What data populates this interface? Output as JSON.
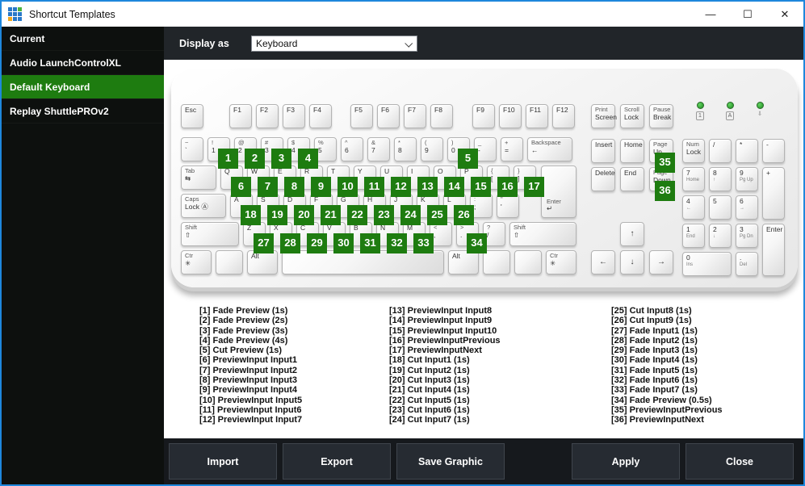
{
  "colors": {
    "accent_green": "#1e7c10",
    "window_border_blue": "#1e87dc",
    "led_green": "#2f9a2f"
  },
  "window": {
    "title": "Shortcut Templates",
    "controls": {
      "minimize": "—",
      "maximize": "☐",
      "close": "✕"
    },
    "icon_cells": [
      "#2878c8",
      "#2878c8",
      "#4ab33e",
      "#2878c8",
      "#2878c8",
      "#2878c8",
      "#f2a71b",
      "#2878c8",
      "#2878c8"
    ]
  },
  "sidebar": {
    "items": [
      {
        "label": "Current",
        "selected": false
      },
      {
        "label": "Audio LaunchControlXL",
        "selected": false
      },
      {
        "label": "Default Keyboard",
        "selected": true
      },
      {
        "label": "Replay ShuttlePROv2",
        "selected": false
      }
    ]
  },
  "toolbar": {
    "display_as_label": "Display as",
    "display_as_value": "Keyboard"
  },
  "keyboard": {
    "esc": {
      "l": "Esc"
    },
    "fn_groups": [
      [
        {
          "l": "F1"
        },
        {
          "l": "F2"
        },
        {
          "l": "F3"
        },
        {
          "l": "F4"
        }
      ],
      [
        {
          "l": "F5"
        },
        {
          "l": "F6"
        },
        {
          "l": "F7"
        },
        {
          "l": "F8"
        }
      ],
      [
        {
          "l": "F9"
        },
        {
          "l": "F10"
        },
        {
          "l": "F11"
        },
        {
          "l": "F12"
        }
      ]
    ],
    "sys_keys": [
      {
        "t": "Print",
        "l": "Screen",
        "cls": "k-nav"
      },
      {
        "t": "Scroll",
        "l": "Lock",
        "cls": "k-nav"
      },
      {
        "t": "Pause",
        "l": "Break",
        "cls": "k-nav"
      }
    ],
    "leds": [
      {
        "glyph": "1",
        "boxed": true,
        "name": "num-lock-led"
      },
      {
        "glyph": "A",
        "boxed": true,
        "name": "caps-lock-led"
      },
      {
        "glyph": "⇩",
        "boxed": false,
        "name": "scroll-lock-led"
      }
    ],
    "main_rows": [
      [
        {
          "t": "~",
          "l": "`"
        },
        {
          "t": "!",
          "l": "1",
          "b": 1
        },
        {
          "t": "@",
          "l": "2",
          "b": 2
        },
        {
          "t": "#",
          "l": "3",
          "b": 3
        },
        {
          "t": "$",
          "l": "4",
          "b": 4
        },
        {
          "t": "%",
          "l": "5"
        },
        {
          "t": "^",
          "l": "6"
        },
        {
          "t": "&",
          "l": "7"
        },
        {
          "t": "*",
          "l": "8"
        },
        {
          "t": "(",
          "l": "9"
        },
        {
          "t": ")",
          "l": "0",
          "b": 5
        },
        {
          "t": "_",
          "l": "-"
        },
        {
          "t": "+",
          "l": "="
        },
        {
          "t": "Backspace",
          "l": "←",
          "cls": "k-back"
        }
      ],
      [
        {
          "t": "Tab",
          "l": "⇆",
          "cls": "k-tab"
        },
        {
          "l": "Q",
          "b": 6
        },
        {
          "l": "W",
          "b": 7
        },
        {
          "l": "E",
          "b": 8
        },
        {
          "l": "R",
          "b": 9
        },
        {
          "l": "T",
          "b": 10
        },
        {
          "l": "Y",
          "b": 11
        },
        {
          "l": "U",
          "b": 12
        },
        {
          "l": "I",
          "b": 13
        },
        {
          "l": "O",
          "b": 14
        },
        {
          "l": "P",
          "b": 15
        },
        {
          "t": "{",
          "l": "[",
          "b": 16
        },
        {
          "t": "}",
          "l": "]",
          "b": 17
        }
      ],
      [
        {
          "t": "Caps",
          "l": "Lock Ⓐ",
          "cls": "k-caps"
        },
        {
          "l": "A",
          "b": 18
        },
        {
          "l": "S",
          "b": 19
        },
        {
          "l": "D",
          "b": 20
        },
        {
          "l": "F",
          "b": 21
        },
        {
          "l": "G",
          "b": 22
        },
        {
          "l": "H",
          "b": 23
        },
        {
          "l": "J",
          "b": 24
        },
        {
          "l": "K",
          "b": 25
        },
        {
          "l": "L",
          "b": 26
        },
        {
          "t": ":",
          "l": ";"
        },
        {
          "t": "\"",
          "l": "'"
        }
      ],
      [
        {
          "t": "Shift",
          "l": "⇧",
          "cls": "k-shift-l"
        },
        {
          "l": "Z",
          "b": 27
        },
        {
          "l": "X",
          "b": 28
        },
        {
          "l": "C",
          "b": 29
        },
        {
          "l": "V",
          "b": 30
        },
        {
          "l": "B",
          "b": 31
        },
        {
          "l": "N",
          "b": 32
        },
        {
          "l": "M",
          "b": 33
        },
        {
          "t": "<",
          "l": ","
        },
        {
          "t": ">",
          "l": ".",
          "b": 34
        },
        {
          "t": "?",
          "l": "/"
        },
        {
          "t": "Shift",
          "l": "⇧",
          "cls": "k-grow"
        }
      ],
      [
        {
          "t": "Ctr",
          "l": "✳",
          "cls": "k-ctr"
        },
        {
          "cls": "k-win"
        },
        {
          "l": "Alt",
          "cls": "k-alt"
        },
        {
          "cls": "k-space"
        },
        {
          "l": "Alt",
          "cls": "k-alt"
        },
        {
          "cls": "k-win"
        },
        {
          "cls": "k-win"
        },
        {
          "t": "Ctr",
          "l": "✳",
          "cls": "k-ctr"
        }
      ]
    ],
    "enter_main": {
      "t": "Enter",
      "l": "↵"
    },
    "nav_rows": [
      [
        {
          "l": "Insert",
          "cls": "k-nav"
        },
        {
          "l": "Home",
          "cls": "k-nav"
        },
        {
          "t": "Page",
          "l": "Up",
          "b": 35,
          "cls": "k-nav"
        }
      ],
      [
        {
          "l": "Delete",
          "cls": "k-nav"
        },
        {
          "l": "End",
          "cls": "k-nav"
        },
        {
          "t": "Page",
          "l": "Down",
          "b": 36,
          "cls": "k-nav"
        }
      ]
    ],
    "arrow_up": {
      "l": "↑",
      "cls": "k-arrow k-cent"
    },
    "arrow_row": [
      {
        "l": "←",
        "cls": "k-arrow k-cent"
      },
      {
        "l": "↓",
        "cls": "k-arrow k-cent"
      },
      {
        "l": "→",
        "cls": "k-arrow k-cent"
      }
    ],
    "numpad": [
      {
        "t": "Num",
        "l": "Lock",
        "row": 0,
        "col": 0
      },
      {
        "l": "/",
        "row": 0,
        "col": 1
      },
      {
        "l": "*",
        "row": 0,
        "col": 2
      },
      {
        "l": "-",
        "row": 0,
        "col": 3
      },
      {
        "l": "7",
        "s": "Home",
        "row": 1,
        "col": 0
      },
      {
        "l": "8",
        "s": "↑",
        "row": 1,
        "col": 1
      },
      {
        "l": "9",
        "s": "Pg Up",
        "row": 1,
        "col": 2
      },
      {
        "l": "+",
        "row": 1,
        "col": 3,
        "tall": true
      },
      {
        "l": "4",
        "s": "←",
        "row": 2,
        "col": 0
      },
      {
        "l": "5",
        "row": 2,
        "col": 1
      },
      {
        "l": "6",
        "s": "→",
        "row": 2,
        "col": 2
      },
      {
        "l": "1",
        "s": "End",
        "row": 3,
        "col": 0
      },
      {
        "l": "2",
        "s": "↓",
        "row": 3,
        "col": 1
      },
      {
        "l": "3",
        "s": "Pg Dn",
        "row": 3,
        "col": 2
      },
      {
        "l": "Enter",
        "row": 3,
        "col": 3,
        "tall": true
      },
      {
        "l": "0",
        "s": "Ins",
        "row": 4,
        "col": 0,
        "wide": true
      },
      {
        "l": ".",
        "s": "Del",
        "row": 4,
        "col": 2
      }
    ]
  },
  "legend": {
    "columns": [
      [
        "[1] Fade Preview (1s)",
        "[2] Fade Preview (2s)",
        "[3] Fade Preview (3s)",
        "[4] Fade Preview (4s)",
        "[5] Cut Preview (1s)",
        "[6] PreviewInput Input1",
        "[7] PreviewInput Input2",
        "[8] PreviewInput Input3",
        "[9] PreviewInput Input4",
        "[10] PreviewInput Input5",
        "[11] PreviewInput Input6",
        "[12] PreviewInput Input7"
      ],
      [
        "[13] PreviewInput Input8",
        "[14] PreviewInput Input9",
        "[15] PreviewInput Input10",
        "[16] PreviewInputPrevious",
        "[17] PreviewInputNext",
        "[18] Cut Input1 (1s)",
        "[19] Cut Input2 (1s)",
        "[20] Cut Input3 (1s)",
        "[21] Cut Input4 (1s)",
        "[22] Cut Input5 (1s)",
        "[23] Cut Input6 (1s)",
        "[24] Cut Input7 (1s)"
      ],
      [
        "[25] Cut Input8 (1s)",
        "[26] Cut Input9 (1s)",
        "[27] Fade Input1 (1s)",
        "[28] Fade Input2 (1s)",
        "[29] Fade Input3 (1s)",
        "[30] Fade Input4 (1s)",
        "[31] Fade Input5 (1s)",
        "[32] Fade Input6 (1s)",
        "[33] Fade Input7 (1s)",
        "[34] Fade Preview (0.5s)",
        "[35] PreviewInputPrevious",
        "[36] PreviewInputNext"
      ]
    ]
  },
  "footer": {
    "left_buttons": [
      "Import",
      "Export",
      "Save Graphic"
    ],
    "right_buttons": [
      "Apply",
      "Close"
    ]
  }
}
